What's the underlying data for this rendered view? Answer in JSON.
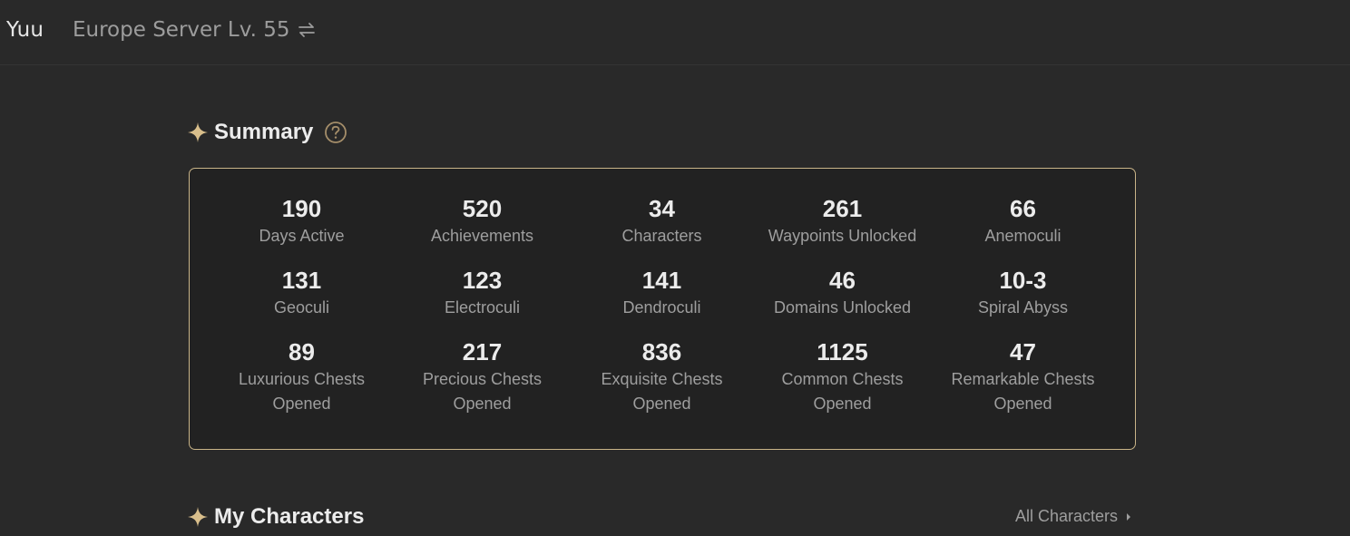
{
  "header": {
    "username": "Yuu",
    "server_label": "Europe Server Lv. 55",
    "swap_icon": "swap-arrows-icon"
  },
  "summary": {
    "title": "Summary",
    "help_icon": "question-circle-icon",
    "stats": [
      {
        "value": "190",
        "label": "Days Active"
      },
      {
        "value": "520",
        "label": "Achievements"
      },
      {
        "value": "34",
        "label": "Characters"
      },
      {
        "value": "261",
        "label": "Waypoints Unlocked"
      },
      {
        "value": "66",
        "label": "Anemoculi"
      },
      {
        "value": "131",
        "label": "Geoculi"
      },
      {
        "value": "123",
        "label": "Electroculi"
      },
      {
        "value": "141",
        "label": "Dendroculi"
      },
      {
        "value": "46",
        "label": "Domains Unlocked"
      },
      {
        "value": "10-3",
        "label": "Spiral Abyss"
      },
      {
        "value": "89",
        "label": "Luxurious Chests\nOpened"
      },
      {
        "value": "217",
        "label": "Precious Chests\nOpened"
      },
      {
        "value": "836",
        "label": "Exquisite Chests\nOpened"
      },
      {
        "value": "1125",
        "label": "Common Chests\nOpened"
      },
      {
        "value": "47",
        "label": "Remarkable Chests\nOpened"
      }
    ]
  },
  "characters": {
    "title": "My Characters",
    "all_link": "All Characters"
  },
  "colors": {
    "background": "#292929",
    "card": "#222222",
    "accent_gold": "#c9b488",
    "text_primary": "#ececec",
    "text_secondary": "#9e9e9e"
  }
}
